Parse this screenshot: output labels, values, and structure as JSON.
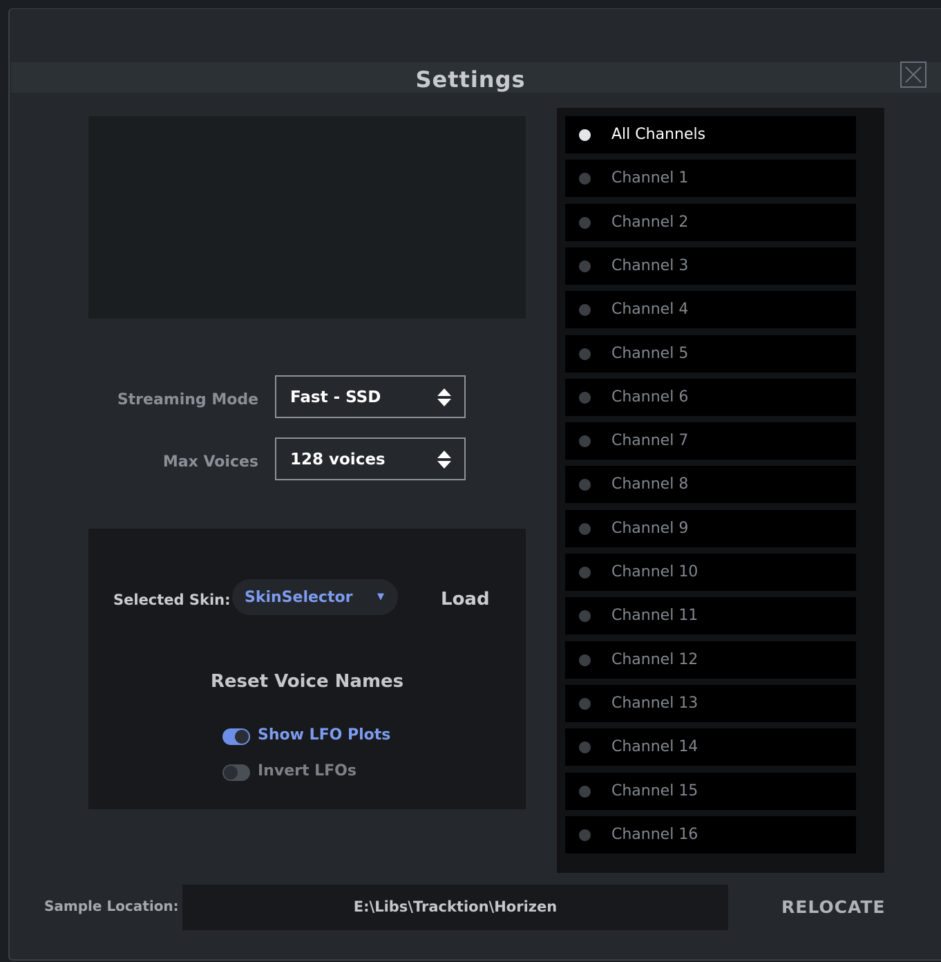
{
  "window": {
    "title": "Settings"
  },
  "streaming": {
    "label": "Streaming Mode",
    "value": "Fast - SSD"
  },
  "voices": {
    "label": "Max Voices",
    "value": "128 voices"
  },
  "skin": {
    "label": "Selected Skin:",
    "value": "SkinSelector",
    "arrow": "▼",
    "load_label": "Load"
  },
  "reset_voice_names_label": "Reset Voice Names",
  "toggles": {
    "show_lfo_plots": {
      "label": "Show LFO Plots",
      "on": true
    },
    "invert_lfos": {
      "label": "Invert LFOs",
      "on": false
    }
  },
  "channels": [
    {
      "label": "All Channels",
      "active": true
    },
    {
      "label": "Channel 1",
      "active": false
    },
    {
      "label": "Channel 2",
      "active": false
    },
    {
      "label": "Channel 3",
      "active": false
    },
    {
      "label": "Channel 4",
      "active": false
    },
    {
      "label": "Channel 5",
      "active": false
    },
    {
      "label": "Channel 6",
      "active": false
    },
    {
      "label": "Channel 7",
      "active": false
    },
    {
      "label": "Channel 8",
      "active": false
    },
    {
      "label": "Channel 9",
      "active": false
    },
    {
      "label": "Channel 10",
      "active": false
    },
    {
      "label": "Channel 11",
      "active": false
    },
    {
      "label": "Channel 12",
      "active": false
    },
    {
      "label": "Channel 13",
      "active": false
    },
    {
      "label": "Channel 14",
      "active": false
    },
    {
      "label": "Channel 15",
      "active": false
    },
    {
      "label": "Channel 16",
      "active": false
    }
  ],
  "sample": {
    "label": "Sample Location:",
    "path": "E:\\Libs\\Tracktion\\Horizen",
    "relocate_label": "RELOCATE"
  },
  "icons": {
    "close": "close-icon",
    "select_arrows": "updown-arrows-icon",
    "dropdown": "chevron-down-icon",
    "radio": "radio-dot-icon"
  },
  "colors": {
    "accent": "#7d9bf0",
    "toggle_on": "#6e8fe8",
    "background": "#25292e",
    "channel_bg": "#000000"
  }
}
